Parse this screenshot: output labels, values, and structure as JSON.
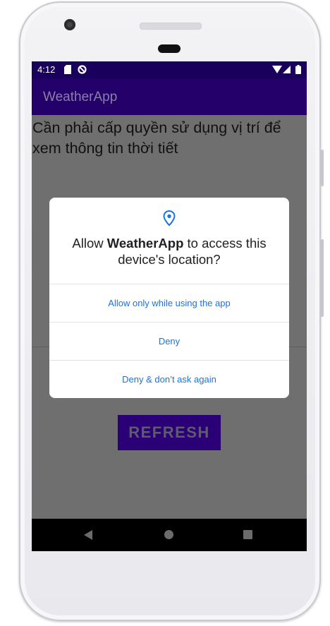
{
  "device": {
    "status_bar": {
      "time": "4:12"
    },
    "nav_bar": {
      "back": "back-icon",
      "home": "home-icon",
      "recents": "recents-icon"
    }
  },
  "app": {
    "title": "WeatherApp",
    "message": "Cần phải cấp quyền sử dụng vị trí để xem thông tin thời tiết",
    "refresh_label": "REFRESH"
  },
  "dialog": {
    "icon": "location-pin-icon",
    "title_prefix": "Allow ",
    "title_app": "WeatherApp",
    "title_suffix": " to access this device's location?",
    "options": [
      {
        "label": "Allow only while using the app"
      },
      {
        "label": "Deny"
      },
      {
        "label": "Deny & don’t ask again"
      }
    ]
  },
  "colors": {
    "status_bar": "#19005c",
    "app_bar": "#24006b",
    "accent_link": "#1a73e8",
    "refresh_button": "#2b0077",
    "scrim_content": "#6f6f6f"
  }
}
